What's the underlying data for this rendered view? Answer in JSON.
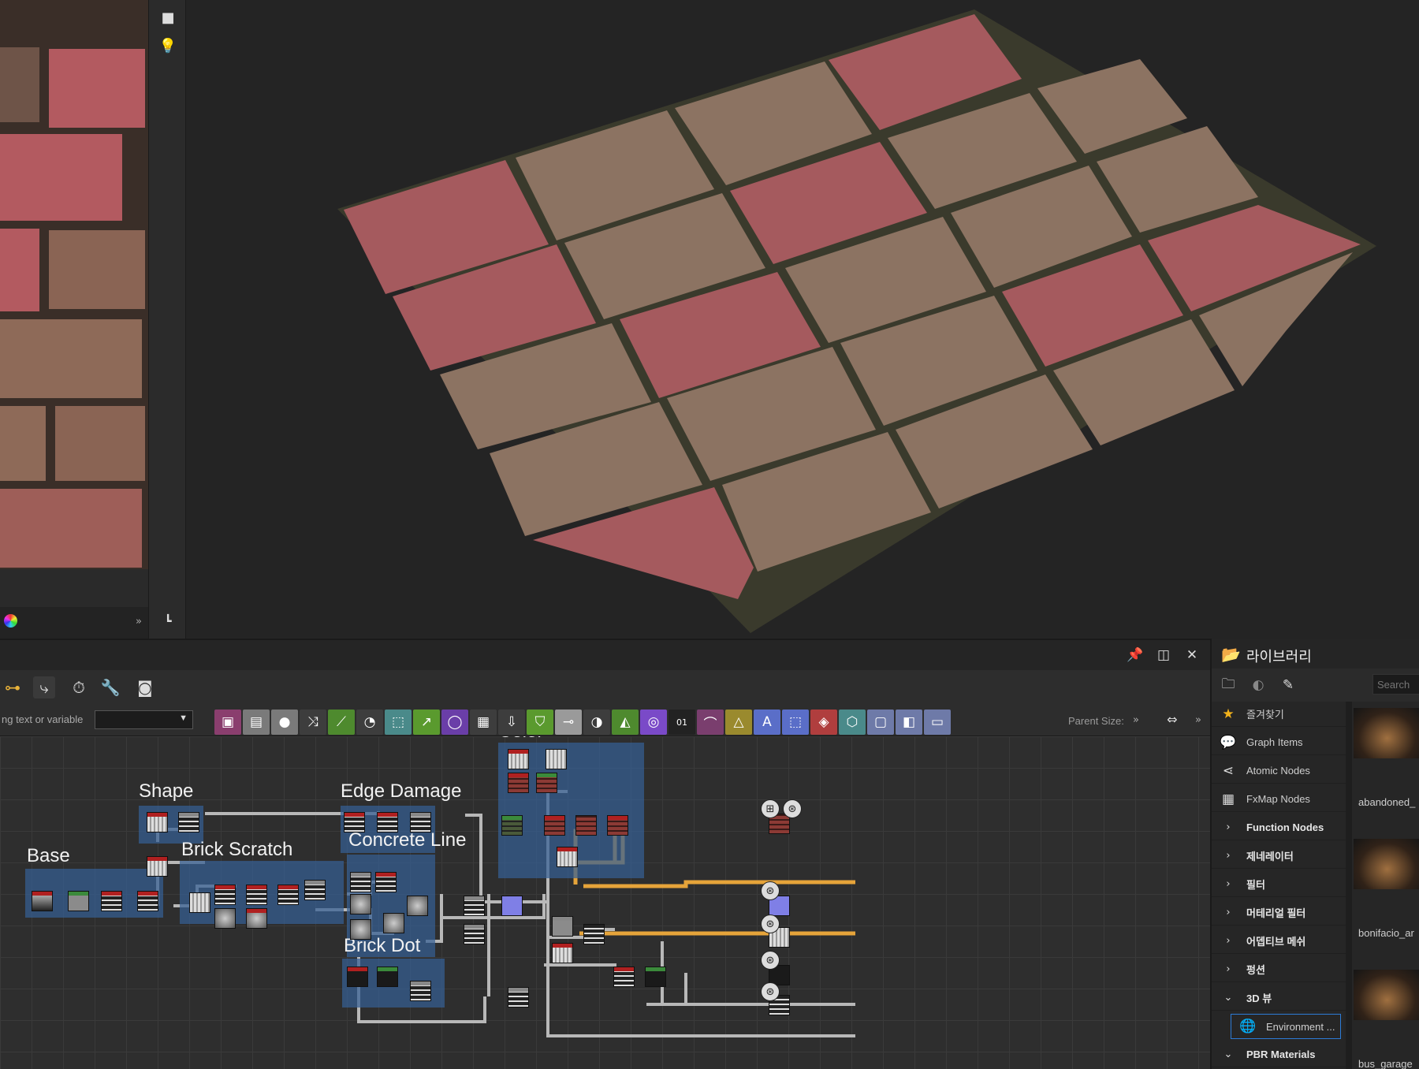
{
  "viewport_3d": {
    "camera_icon": "camera-icon",
    "light_icon": "light-bulb-icon"
  },
  "view_2d": {
    "expand": "»"
  },
  "graph_panel": {
    "pin_icon": "pin-icon",
    "maximize_icon": "maximize-icon",
    "close_icon": "close-icon",
    "filter_placeholder": "ng text or variable",
    "parent_size_label": "Parent Size:",
    "more": "»",
    "frames": {
      "shape": "Shape",
      "edge_damage": "Edge Damage",
      "color": "Color",
      "base": "Base",
      "brick_scratch": "Brick Scratch",
      "concrete_line": "Concrete Line",
      "brick_dot": "Brick Dot"
    },
    "node_button_colors": [
      "#8a3e6e",
      "#7a7a7a",
      "#7a7a7a",
      "#3d3d3d",
      "#4e8a2e",
      "#3d3d3d",
      "#4a8a8a",
      "#5a9a2e",
      "#6a3ea8",
      "#3d3d3d",
      "#3d3d3d",
      "#5a9a2e",
      "#9a9a9a",
      "#3d3d3d",
      "#4e8a2e",
      "#7a4ac8",
      "#222222",
      "#7a3e6e",
      "#9a8a2e",
      "#5a6ec8",
      "#5a6ec8",
      "#b03e3e",
      "#4a8a8a",
      "#6e7aa8",
      "#6e7aa8",
      "#6e7aa8"
    ],
    "node_button_glyph_01": "01",
    "node_button_glyph_a": "A"
  },
  "library": {
    "title": "라이브러리",
    "search_placeholder": "Search",
    "items": [
      {
        "label": "즐겨찾기",
        "icon": "★"
      },
      {
        "label": "Graph Items",
        "icon": "💬"
      },
      {
        "label": "Atomic Nodes",
        "icon": "⋖"
      },
      {
        "label": "FxMap Nodes",
        "icon": "▦"
      }
    ],
    "categories": [
      {
        "label": "Function Nodes",
        "expanded": false
      },
      {
        "label": "제네레이터",
        "expanded": false
      },
      {
        "label": "필터",
        "expanded": false
      },
      {
        "label": "머테리얼 필터",
        "expanded": false
      },
      {
        "label": "어뎁티브 메쉬",
        "expanded": false
      },
      {
        "label": "펑션",
        "expanded": false
      },
      {
        "label": "3D 뷰",
        "expanded": true
      }
    ],
    "selected_item": "Environment ...",
    "last_category": "PBR Materials",
    "thumbs": [
      "abandoned_",
      "bonifacio_ar",
      "bus_garage"
    ]
  }
}
